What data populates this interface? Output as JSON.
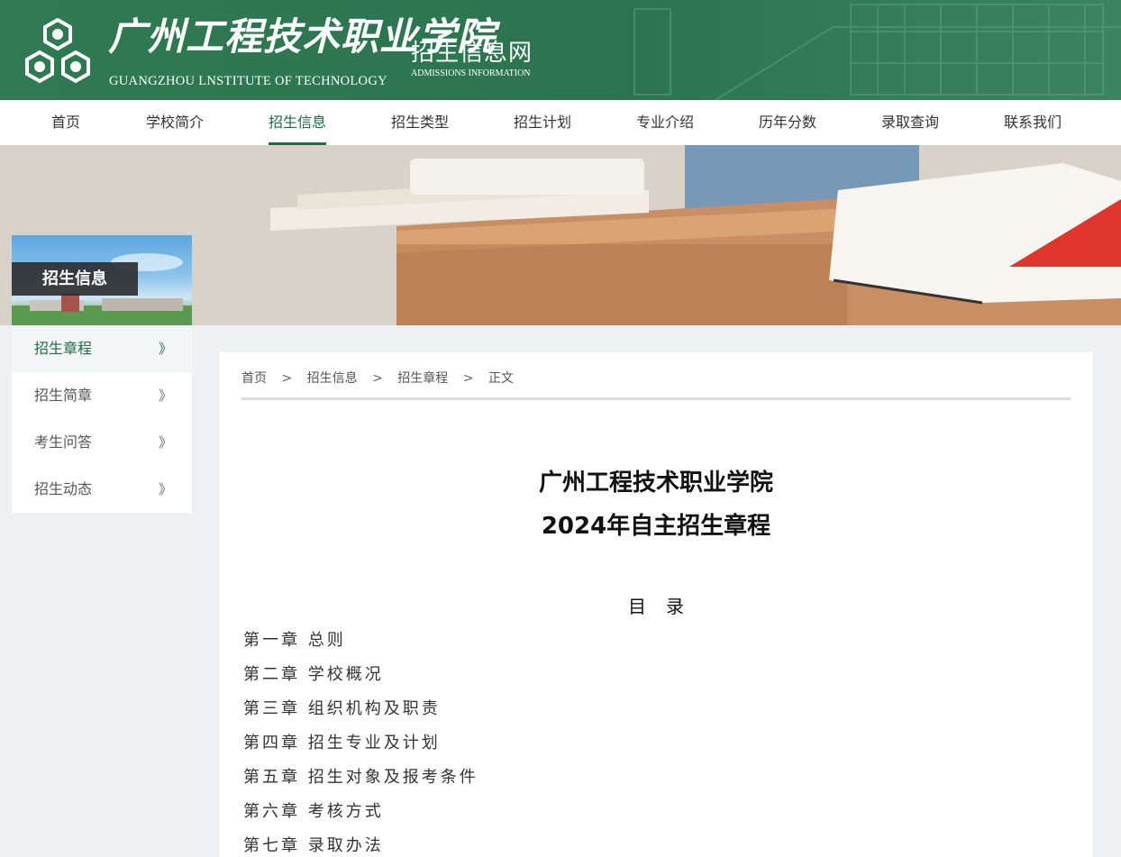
{
  "header": {
    "logo_cn": "广州工程技术职业学院",
    "logo_en": "GUANGZHOU LNSTITUTE OF TECHNOLOGY",
    "site_cn": "招生信息网",
    "site_en": "ADMISSIONS INFORMATION",
    "brand_color": "#2b7450"
  },
  "nav": {
    "items": [
      {
        "label": "首页"
      },
      {
        "label": "学校简介"
      },
      {
        "label": "招生信息"
      },
      {
        "label": "招生类型"
      },
      {
        "label": "招生计划"
      },
      {
        "label": "专业介绍"
      },
      {
        "label": "历年分数"
      },
      {
        "label": "录取查询"
      },
      {
        "label": "联系我们"
      }
    ],
    "active": "招生信息",
    "accent_color": "#1f6b44"
  },
  "sidebar": {
    "title": "招生信息",
    "items": [
      {
        "label": "招生章程",
        "chevron": "》"
      },
      {
        "label": "招生简章",
        "chevron": "》"
      },
      {
        "label": "考生问答",
        "chevron": "》"
      },
      {
        "label": "招生动态",
        "chevron": "》"
      }
    ],
    "active": "招生章程"
  },
  "breadcrumb": {
    "separator": ">",
    "items": [
      "首页",
      "招生信息",
      "招生章程",
      "正文"
    ]
  },
  "article": {
    "title_line1": "广州工程技术职业学院",
    "title_line2": "2024年自主招生章程",
    "toc_heading": "目录",
    "toc": [
      "第一章 总则",
      "第二章 学校概况",
      "第三章 组织机构及职责",
      "第四章 招生专业及计划",
      "第五章 招生对象及报考条件",
      "第六章 考核方式",
      "第七章 录取办法"
    ]
  }
}
